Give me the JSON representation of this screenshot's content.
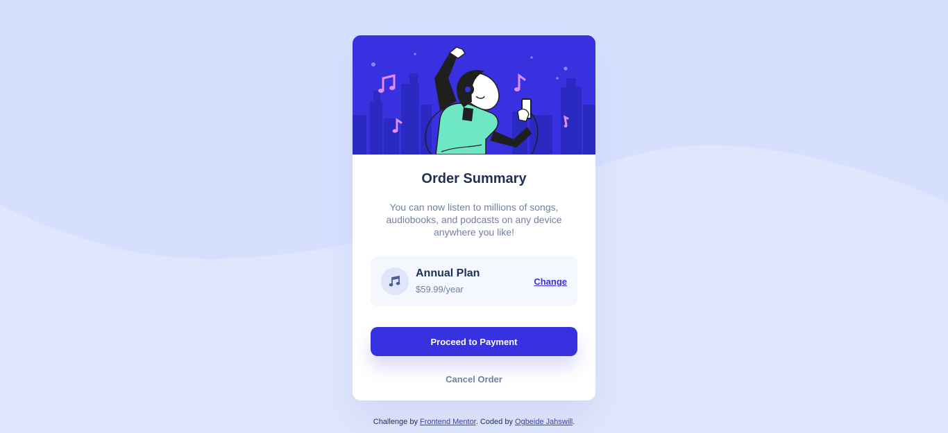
{
  "card": {
    "title": "Order Summary",
    "description": "You can now listen to millions of songs, audiobooks, and podcasts on any device anywhere you like!",
    "plan": {
      "icon": "music-note-icon",
      "name": "Annual Plan",
      "price": "$59.99/year",
      "change_label": "Change"
    },
    "proceed_label": "Proceed to Payment",
    "cancel_label": "Cancel Order"
  },
  "footer": {
    "prefix": "Challenge by",
    "mentor_link": "Frontend Mentor",
    "middle": ". Coded by",
    "author_link": "Ogbeide Jahswill",
    "suffix": "."
  },
  "colors": {
    "background": "#dfe6fd",
    "wave": "#d6e0fe",
    "primary": "#3831e0",
    "dark": "#1f2f56",
    "desaturated": "#717fa6",
    "plan_bg": "#f5f7ff"
  }
}
